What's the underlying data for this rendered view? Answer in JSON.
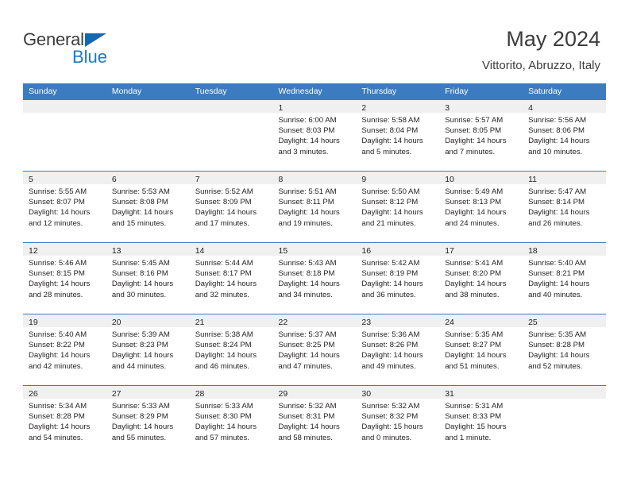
{
  "brand": {
    "name_part1": "General",
    "name_part2": "Blue",
    "triangle_color": "#1367b0",
    "blue_color": "#1c7bc4"
  },
  "header": {
    "month_title": "May 2024",
    "location": "Vittorito, Abruzzo, Italy"
  },
  "theme": {
    "header_blue": "#3b7cc0",
    "band_gray": "#f0f0f0",
    "text": "#231f20"
  },
  "calendar": {
    "weekday_headers": [
      "Sunday",
      "Monday",
      "Tuesday",
      "Wednesday",
      "Thursday",
      "Friday",
      "Saturday"
    ],
    "weeks": [
      [
        {
          "empty": true
        },
        {
          "empty": true
        },
        {
          "empty": true
        },
        {
          "day": "1",
          "sunrise": "Sunrise: 6:00 AM",
          "sunset": "Sunset: 8:03 PM",
          "daylight_line1": "Daylight: 14 hours",
          "daylight_line2": "and 3 minutes."
        },
        {
          "day": "2",
          "sunrise": "Sunrise: 5:58 AM",
          "sunset": "Sunset: 8:04 PM",
          "daylight_line1": "Daylight: 14 hours",
          "daylight_line2": "and 5 minutes."
        },
        {
          "day": "3",
          "sunrise": "Sunrise: 5:57 AM",
          "sunset": "Sunset: 8:05 PM",
          "daylight_line1": "Daylight: 14 hours",
          "daylight_line2": "and 7 minutes."
        },
        {
          "day": "4",
          "sunrise": "Sunrise: 5:56 AM",
          "sunset": "Sunset: 8:06 PM",
          "daylight_line1": "Daylight: 14 hours",
          "daylight_line2": "and 10 minutes."
        }
      ],
      [
        {
          "day": "5",
          "sunrise": "Sunrise: 5:55 AM",
          "sunset": "Sunset: 8:07 PM",
          "daylight_line1": "Daylight: 14 hours",
          "daylight_line2": "and 12 minutes."
        },
        {
          "day": "6",
          "sunrise": "Sunrise: 5:53 AM",
          "sunset": "Sunset: 8:08 PM",
          "daylight_line1": "Daylight: 14 hours",
          "daylight_line2": "and 15 minutes."
        },
        {
          "day": "7",
          "sunrise": "Sunrise: 5:52 AM",
          "sunset": "Sunset: 8:09 PM",
          "daylight_line1": "Daylight: 14 hours",
          "daylight_line2": "and 17 minutes."
        },
        {
          "day": "8",
          "sunrise": "Sunrise: 5:51 AM",
          "sunset": "Sunset: 8:11 PM",
          "daylight_line1": "Daylight: 14 hours",
          "daylight_line2": "and 19 minutes."
        },
        {
          "day": "9",
          "sunrise": "Sunrise: 5:50 AM",
          "sunset": "Sunset: 8:12 PM",
          "daylight_line1": "Daylight: 14 hours",
          "daylight_line2": "and 21 minutes."
        },
        {
          "day": "10",
          "sunrise": "Sunrise: 5:49 AM",
          "sunset": "Sunset: 8:13 PM",
          "daylight_line1": "Daylight: 14 hours",
          "daylight_line2": "and 24 minutes."
        },
        {
          "day": "11",
          "sunrise": "Sunrise: 5:47 AM",
          "sunset": "Sunset: 8:14 PM",
          "daylight_line1": "Daylight: 14 hours",
          "daylight_line2": "and 26 minutes."
        }
      ],
      [
        {
          "day": "12",
          "sunrise": "Sunrise: 5:46 AM",
          "sunset": "Sunset: 8:15 PM",
          "daylight_line1": "Daylight: 14 hours",
          "daylight_line2": "and 28 minutes."
        },
        {
          "day": "13",
          "sunrise": "Sunrise: 5:45 AM",
          "sunset": "Sunset: 8:16 PM",
          "daylight_line1": "Daylight: 14 hours",
          "daylight_line2": "and 30 minutes."
        },
        {
          "day": "14",
          "sunrise": "Sunrise: 5:44 AM",
          "sunset": "Sunset: 8:17 PM",
          "daylight_line1": "Daylight: 14 hours",
          "daylight_line2": "and 32 minutes."
        },
        {
          "day": "15",
          "sunrise": "Sunrise: 5:43 AM",
          "sunset": "Sunset: 8:18 PM",
          "daylight_line1": "Daylight: 14 hours",
          "daylight_line2": "and 34 minutes."
        },
        {
          "day": "16",
          "sunrise": "Sunrise: 5:42 AM",
          "sunset": "Sunset: 8:19 PM",
          "daylight_line1": "Daylight: 14 hours",
          "daylight_line2": "and 36 minutes."
        },
        {
          "day": "17",
          "sunrise": "Sunrise: 5:41 AM",
          "sunset": "Sunset: 8:20 PM",
          "daylight_line1": "Daylight: 14 hours",
          "daylight_line2": "and 38 minutes."
        },
        {
          "day": "18",
          "sunrise": "Sunrise: 5:40 AM",
          "sunset": "Sunset: 8:21 PM",
          "daylight_line1": "Daylight: 14 hours",
          "daylight_line2": "and 40 minutes."
        }
      ],
      [
        {
          "day": "19",
          "sunrise": "Sunrise: 5:40 AM",
          "sunset": "Sunset: 8:22 PM",
          "daylight_line1": "Daylight: 14 hours",
          "daylight_line2": "and 42 minutes."
        },
        {
          "day": "20",
          "sunrise": "Sunrise: 5:39 AM",
          "sunset": "Sunset: 8:23 PM",
          "daylight_line1": "Daylight: 14 hours",
          "daylight_line2": "and 44 minutes."
        },
        {
          "day": "21",
          "sunrise": "Sunrise: 5:38 AM",
          "sunset": "Sunset: 8:24 PM",
          "daylight_line1": "Daylight: 14 hours",
          "daylight_line2": "and 46 minutes."
        },
        {
          "day": "22",
          "sunrise": "Sunrise: 5:37 AM",
          "sunset": "Sunset: 8:25 PM",
          "daylight_line1": "Daylight: 14 hours",
          "daylight_line2": "and 47 minutes."
        },
        {
          "day": "23",
          "sunrise": "Sunrise: 5:36 AM",
          "sunset": "Sunset: 8:26 PM",
          "daylight_line1": "Daylight: 14 hours",
          "daylight_line2": "and 49 minutes."
        },
        {
          "day": "24",
          "sunrise": "Sunrise: 5:35 AM",
          "sunset": "Sunset: 8:27 PM",
          "daylight_line1": "Daylight: 14 hours",
          "daylight_line2": "and 51 minutes."
        },
        {
          "day": "25",
          "sunrise": "Sunrise: 5:35 AM",
          "sunset": "Sunset: 8:28 PM",
          "daylight_line1": "Daylight: 14 hours",
          "daylight_line2": "and 52 minutes."
        }
      ],
      [
        {
          "day": "26",
          "sunrise": "Sunrise: 5:34 AM",
          "sunset": "Sunset: 8:28 PM",
          "daylight_line1": "Daylight: 14 hours",
          "daylight_line2": "and 54 minutes."
        },
        {
          "day": "27",
          "sunrise": "Sunrise: 5:33 AM",
          "sunset": "Sunset: 8:29 PM",
          "daylight_line1": "Daylight: 14 hours",
          "daylight_line2": "and 55 minutes."
        },
        {
          "day": "28",
          "sunrise": "Sunrise: 5:33 AM",
          "sunset": "Sunset: 8:30 PM",
          "daylight_line1": "Daylight: 14 hours",
          "daylight_line2": "and 57 minutes."
        },
        {
          "day": "29",
          "sunrise": "Sunrise: 5:32 AM",
          "sunset": "Sunset: 8:31 PM",
          "daylight_line1": "Daylight: 14 hours",
          "daylight_line2": "and 58 minutes."
        },
        {
          "day": "30",
          "sunrise": "Sunrise: 5:32 AM",
          "sunset": "Sunset: 8:32 PM",
          "daylight_line1": "Daylight: 15 hours",
          "daylight_line2": "and 0 minutes."
        },
        {
          "day": "31",
          "sunrise": "Sunrise: 5:31 AM",
          "sunset": "Sunset: 8:33 PM",
          "daylight_line1": "Daylight: 15 hours",
          "daylight_line2": "and 1 minute."
        },
        {
          "empty": true
        }
      ]
    ]
  }
}
